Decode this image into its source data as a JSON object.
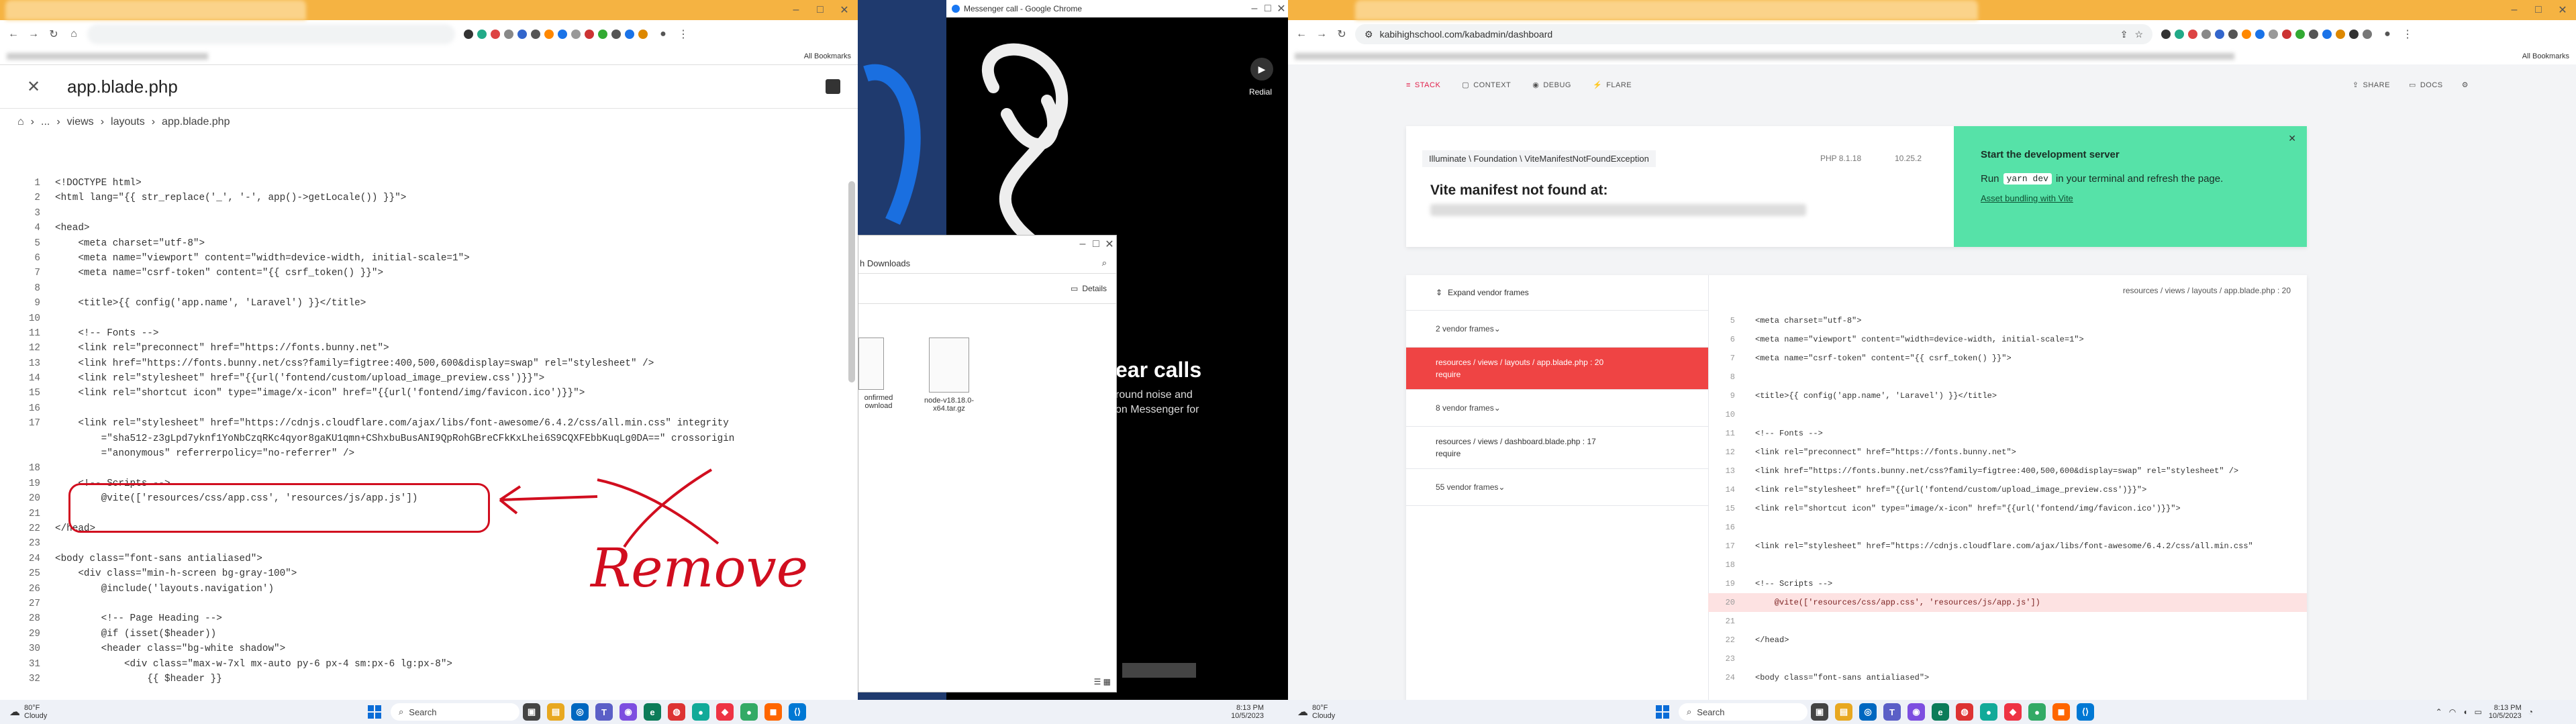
{
  "left_window": {
    "bookmarks_label": "All Bookmarks",
    "editor": {
      "file_title": "app.blade.php",
      "breadcrumb": [
        "...",
        "views",
        "layouts",
        "app.blade.php"
      ],
      "code_lines": [
        {
          "n": "1",
          "t": "<!DOCTYPE html>"
        },
        {
          "n": "2",
          "t": "<html lang=\"{{ str_replace('_', '-', app()->getLocale()) }}\">"
        },
        {
          "n": "3",
          "t": ""
        },
        {
          "n": "4",
          "t": "<head>"
        },
        {
          "n": "5",
          "t": "    <meta charset=\"utf-8\">"
        },
        {
          "n": "6",
          "t": "    <meta name=\"viewport\" content=\"width=device-width, initial-scale=1\">"
        },
        {
          "n": "7",
          "t": "    <meta name=\"csrf-token\" content=\"{{ csrf_token() }}\">"
        },
        {
          "n": "8",
          "t": ""
        },
        {
          "n": "9",
          "t": "    <title>{{ config('app.name', 'Laravel') }}</title>"
        },
        {
          "n": "10",
          "t": ""
        },
        {
          "n": "11",
          "t": "    <!-- Fonts -->"
        },
        {
          "n": "12",
          "t": "    <link rel=\"preconnect\" href=\"https://fonts.bunny.net\">"
        },
        {
          "n": "13",
          "t": "    <link href=\"https://fonts.bunny.net/css?family=figtree:400,500,600&display=swap\" rel=\"stylesheet\" />"
        },
        {
          "n": "14",
          "t": "    <link rel=\"stylesheet\" href=\"{{url('fontend/custom/upload_image_preview.css')}}\">"
        },
        {
          "n": "15",
          "t": "    <link rel=\"shortcut icon\" type=\"image/x-icon\" href=\"{{url('fontend/img/favicon.ico')}}\">"
        },
        {
          "n": "16",
          "t": ""
        },
        {
          "n": "17",
          "t": "    <link rel=\"stylesheet\" href=\"https://cdnjs.cloudflare.com/ajax/libs/font-awesome/6.4.2/css/all.min.css\" integrity"
        },
        {
          "n": "",
          "t": "        =\"sha512-z3gLpd7yknf1YoNbCzqRKc4qyor8gaKU1qmn+CShxbuBusANI9QpRohGBreCFkKxLhei6S9CQXFEbbKuqLg0DA==\" crossorigin"
        },
        {
          "n": "",
          "t": "        =\"anonymous\" referrerpolicy=\"no-referrer\" />"
        },
        {
          "n": "18",
          "t": ""
        },
        {
          "n": "19",
          "t": "    <!-- Scripts -->"
        },
        {
          "n": "20",
          "t": "        @vite(['resources/css/app.css', 'resources/js/app.js'])"
        },
        {
          "n": "21",
          "t": ""
        },
        {
          "n": "22",
          "t": "</head>"
        },
        {
          "n": "23",
          "t": ""
        },
        {
          "n": "24",
          "t": "<body class=\"font-sans antialiased\">"
        },
        {
          "n": "25",
          "t": "    <div class=\"min-h-screen bg-gray-100\">"
        },
        {
          "n": "26",
          "t": "        @include('layouts.navigation')"
        },
        {
          "n": "27",
          "t": ""
        },
        {
          "n": "28",
          "t": "        <!-- Page Heading -->"
        },
        {
          "n": "29",
          "t": "        @if (isset($header))"
        },
        {
          "n": "30",
          "t": "        <header class=\"bg-white shadow\">"
        },
        {
          "n": "31",
          "t": "            <div class=\"max-w-7xl mx-auto py-6 px-4 sm:px-6 lg:px-8\">"
        },
        {
          "n": "32",
          "t": "                {{ $header }}"
        }
      ],
      "annotation_text": "Remove"
    }
  },
  "messenger_window": {
    "title": "Messenger call - Google Chrome",
    "redial_label": "Redial",
    "heading": "ear calls",
    "subtext_1": "round noise and",
    "subtext_2": "on Messenger for"
  },
  "explorer_window": {
    "location": "h Downloads",
    "details_label": "Details",
    "files": [
      {
        "name_1": "onfirmed",
        "name_2": "ownload"
      },
      {
        "name_1": "node-v18.18.0-",
        "name_2": "x64.tar.gz"
      }
    ]
  },
  "right_window": {
    "url": "kabihighschool.com/kabadmin/dashboard",
    "bookmarks_label": "All Bookmarks",
    "ignition": {
      "nav": [
        "STACK",
        "CONTEXT",
        "DEBUG",
        "FLARE"
      ],
      "share_label": "SHARE",
      "docs_label": "DOCS",
      "exception_class": "Illuminate \\ Foundation \\ ViteManifestNotFoundException",
      "php_version": "PHP 8.1.18",
      "laravel_version": "10.25.2",
      "message": "Vite manifest not found at:",
      "solution_title": "Start the development server",
      "solution_run": "Run",
      "solution_cmd": "yarn dev",
      "solution_text": "in your terminal and refresh the page.",
      "solution_link": "Asset bundling with Vite",
      "expand_vendor": "Expand vendor frames",
      "frames": [
        {
          "kind": "vendor",
          "label": "2 vendor frames"
        },
        {
          "kind": "app-active",
          "path": "resources / views / layouts / app.blade.php : 20",
          "fn": "require"
        },
        {
          "kind": "vendor",
          "label": "8 vendor frames"
        },
        {
          "kind": "app",
          "path": "resources / views / dashboard.blade.php : 17",
          "fn": "require"
        },
        {
          "kind": "vendor",
          "label": "55 vendor frames"
        }
      ],
      "file_path": "resources / views / layouts / app.blade.php : 20",
      "code": [
        {
          "n": "5",
          "t": "<meta charset=\"utf-8\">"
        },
        {
          "n": "6",
          "t": "<meta name=\"viewport\" content=\"width=device-width, initial-scale=1\">"
        },
        {
          "n": "7",
          "t": "<meta name=\"csrf-token\" content=\"{{ csrf_token() }}\">"
        },
        {
          "n": "8",
          "t": ""
        },
        {
          "n": "9",
          "t": "<title>{{ config('app.name', 'Laravel') }}</title>"
        },
        {
          "n": "10",
          "t": ""
        },
        {
          "n": "11",
          "t": "<!-- Fonts -->"
        },
        {
          "n": "12",
          "t": "<link rel=\"preconnect\" href=\"https://fonts.bunny.net\">"
        },
        {
          "n": "13",
          "t": "<link href=\"https://fonts.bunny.net/css?family=figtree:400,500,600&display=swap\" rel=\"stylesheet\" />"
        },
        {
          "n": "14",
          "t": "<link rel=\"stylesheet\" href=\"{{url('fontend/custom/upload_image_preview.css')}}\">"
        },
        {
          "n": "15",
          "t": "<link rel=\"shortcut icon\" type=\"image/x-icon\" href=\"{{url('fontend/img/favicon.ico')}}\">"
        },
        {
          "n": "16",
          "t": ""
        },
        {
          "n": "17",
          "t": "<link rel=\"stylesheet\" href=\"https://cdnjs.cloudflare.com/ajax/libs/font-awesome/6.4.2/css/all.min.css\""
        },
        {
          "n": "18",
          "t": ""
        },
        {
          "n": "19",
          "t": "<!-- Scripts -->"
        },
        {
          "n": "20",
          "t": "    @vite(['resources/css/app.css', 'resources/js/app.js'])"
        },
        {
          "n": "21",
          "t": ""
        },
        {
          "n": "22",
          "t": "</head>"
        },
        {
          "n": "23",
          "t": ""
        },
        {
          "n": "24",
          "t": "<body class=\"font-sans antialiased\">"
        }
      ]
    }
  },
  "taskbar_left": {
    "weather_temp": "80°F",
    "weather_desc": "Cloudy",
    "search_label": "Search",
    "time": "8:13 PM",
    "date": "10/5/2023"
  },
  "taskbar_right": {
    "weather_temp": "80°F",
    "weather_desc": "Cloudy",
    "search_label": "Search",
    "time": "8:13 PM",
    "date": "10/5/2023"
  }
}
